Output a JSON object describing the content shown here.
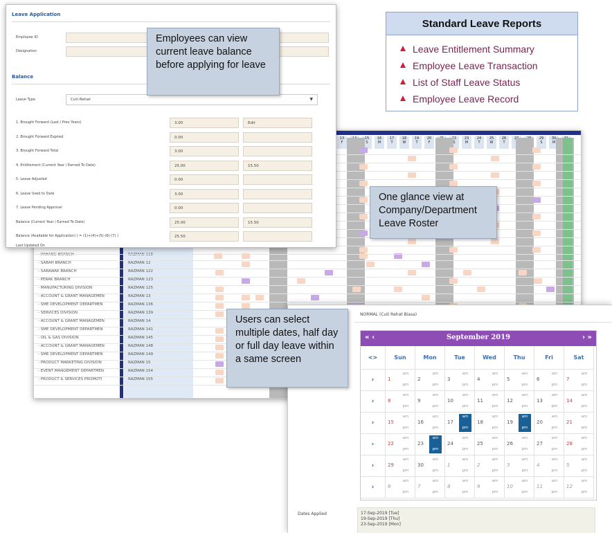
{
  "leave_application": {
    "title": "Leave Application",
    "employee_id_label": "Employee ID",
    "designation_label": "Designation",
    "balance_title": "Balance",
    "leave_type_label": "Leave Type",
    "leave_type_value": "Cuti Rehat",
    "rows": [
      {
        "label": "1. Brought Forward (Last / Prev Years)",
        "value": "3.00",
        "extra": "Edit"
      },
      {
        "label": "2. Brought Forward Expired",
        "value": "0.00",
        "extra": ""
      },
      {
        "label": "3. Brought Forward Total",
        "value": "3.00",
        "extra": ""
      },
      {
        "label": "4. Entitlement (Current Year / Earned To Date)",
        "value": "25.00",
        "extra": "15.50"
      },
      {
        "label": "5. Leave Adjusted",
        "value": "0.00",
        "extra": ""
      },
      {
        "label": "6. Leave Used to Date",
        "value": "3.00",
        "extra": ""
      },
      {
        "label": "7. Leave Pending Approval",
        "value": "0.00",
        "extra": ""
      },
      {
        "label": "Balance (Current Year / Earned To Date)",
        "value": "25.00",
        "extra": "15.50"
      },
      {
        "label": "Balance (Available for Application) ( = (1)+(4)+(5)-(6)-(7) )",
        "value": "25.50",
        "extra": ""
      }
    ],
    "last_updated_label": "Last Updated On"
  },
  "callouts": {
    "balance": "Employees can view current leave balance before applying for leave",
    "roster": "One glance view at Company/Department Leave Roster",
    "calendar": "Users can select multiple dates, half day or full day leave within a same screen"
  },
  "reports": {
    "title": "Standard Leave Reports",
    "items": [
      "Leave Entitlement Summary",
      "Employee Leave Transaction",
      "List of Staff Leave Status",
      "Employee Leave Record"
    ]
  },
  "roster": {
    "header_days": [
      {
        "d": "13",
        "w": "F"
      },
      {
        "d": "14",
        "w": "S"
      },
      {
        "d": "15",
        "w": "S"
      },
      {
        "d": "16",
        "w": "M"
      },
      {
        "d": "17",
        "w": "T"
      },
      {
        "d": "18",
        "w": "W"
      },
      {
        "d": "19",
        "w": "T"
      },
      {
        "d": "20",
        "w": "F"
      },
      {
        "d": "21",
        "w": "S"
      },
      {
        "d": "22",
        "w": "S"
      },
      {
        "d": "23",
        "w": "M"
      },
      {
        "d": "24",
        "w": "T"
      },
      {
        "d": "25",
        "w": "W"
      },
      {
        "d": "26",
        "w": "T"
      },
      {
        "d": "27",
        "w": "F"
      },
      {
        "d": "28",
        "w": "S"
      },
      {
        "d": "29",
        "w": "S"
      },
      {
        "d": "30",
        "w": "M"
      },
      {
        "d": "31",
        "w": "T"
      }
    ],
    "rows": [
      {
        "dept": "- PAHANG BRANCH",
        "emp": "RAZMAN 118"
      },
      {
        "dept": "- SABAH BRANCH",
        "emp": "RAZMAN 12"
      },
      {
        "dept": "- SARAWAK BRANCH",
        "emp": "RAZMAN 122"
      },
      {
        "dept": "- PERAK BRANCH",
        "emp": "RAZMAN 123"
      },
      {
        "dept": "- MANUFACTURING DIVISION",
        "emp": "RAZMAN 125"
      },
      {
        "dept": "- ACCOUNT & GRANT MANAGEMEN",
        "emp": "RAZMAN 13"
      },
      {
        "dept": "- SME DEVELOPMENT DEPARTMEN",
        "emp": "RAZMAN 136"
      },
      {
        "dept": "- SERVICES DIVISION",
        "emp": "RAZMAN 139"
      },
      {
        "dept": "- ACCOUNT & GRANT MANAGEMEN",
        "emp": "RAZMAN 14"
      },
      {
        "dept": "- SME DEVELOPMENT DEPARTMEN",
        "emp": "RAZMAN 141"
      },
      {
        "dept": "- OIL & GAS DIVISION",
        "emp": "RAZMAN 145"
      },
      {
        "dept": "- ACCOUNT & GRANT MANAGEMEN",
        "emp": "RAZMAN 148"
      },
      {
        "dept": "- SME DEVELOPMENT DEPARTMEN",
        "emp": "RAZMAN 149"
      },
      {
        "dept": "- PRODUCT MARKETING DIVISION",
        "emp": "RAZMAN 15"
      },
      {
        "dept": "- EVENT MANGEMENT DEPARTMEN",
        "emp": "RAZMAN 154"
      },
      {
        "dept": "- PRODUCT & SERVICES PROMOTI",
        "emp": "RAZMAN 155"
      }
    ]
  },
  "calendar": {
    "leave_type_line": "NORMAL (Cuti Rehat Biasa)",
    "month_title": "September 2019",
    "prev_label": "« ‹",
    "next_label": "› »",
    "corner_label": "<>",
    "weekdays": [
      "Sun",
      "Mon",
      "Tue",
      "Wed",
      "Thu",
      "Fri",
      "Sat"
    ],
    "am": "am",
    "pm": "pm",
    "week_arrow": "›",
    "weeks": [
      [
        {
          "d": "1",
          "t": "red"
        },
        {
          "d": "2",
          "t": ""
        },
        {
          "d": "3",
          "t": ""
        },
        {
          "d": "4",
          "t": ""
        },
        {
          "d": "5",
          "t": ""
        },
        {
          "d": "6",
          "t": ""
        },
        {
          "d": "7",
          "t": "red"
        }
      ],
      [
        {
          "d": "8",
          "t": "red"
        },
        {
          "d": "9",
          "t": ""
        },
        {
          "d": "10",
          "t": ""
        },
        {
          "d": "11",
          "t": ""
        },
        {
          "d": "12",
          "t": ""
        },
        {
          "d": "13",
          "t": ""
        },
        {
          "d": "14",
          "t": "red"
        }
      ],
      [
        {
          "d": "15",
          "t": "red"
        },
        {
          "d": "16",
          "t": ""
        },
        {
          "d": "17",
          "t": "",
          "hl": true
        },
        {
          "d": "18",
          "t": ""
        },
        {
          "d": "19",
          "t": "",
          "hl": true
        },
        {
          "d": "20",
          "t": ""
        },
        {
          "d": "21",
          "t": "red"
        }
      ],
      [
        {
          "d": "22",
          "t": "red"
        },
        {
          "d": "23",
          "t": "",
          "hl": true
        },
        {
          "d": "24",
          "t": ""
        },
        {
          "d": "25",
          "t": ""
        },
        {
          "d": "26",
          "t": ""
        },
        {
          "d": "27",
          "t": ""
        },
        {
          "d": "28",
          "t": "red"
        }
      ],
      [
        {
          "d": "29",
          "t": "red"
        },
        {
          "d": "30",
          "t": ""
        },
        {
          "d": "1",
          "t": "muted"
        },
        {
          "d": "2",
          "t": "muted"
        },
        {
          "d": "3",
          "t": "muted"
        },
        {
          "d": "4",
          "t": "muted"
        },
        {
          "d": "5",
          "t": "muted"
        }
      ],
      [
        {
          "d": "6",
          "t": "muted"
        },
        {
          "d": "7",
          "t": "muted"
        },
        {
          "d": "8",
          "t": "muted"
        },
        {
          "d": "9",
          "t": "muted"
        },
        {
          "d": "10",
          "t": "muted"
        },
        {
          "d": "11",
          "t": "muted"
        },
        {
          "d": "12",
          "t": "muted"
        }
      ]
    ],
    "dates_applied_label": "Dates Applied",
    "dates_applied": [
      "17-Sep-2019 [Tue]",
      "19-Sep-2019 [Thu]",
      "23-Sep-2019 [Mon]"
    ]
  },
  "colors": {
    "accent_purple": "#8e4db5",
    "highlight_blue": "#1a5f96",
    "roster_navy": "#1f2f8a",
    "report_text": "#7b2252",
    "report_bullet": "#cc1d3d",
    "callout_bg": "#c7d2e0"
  }
}
